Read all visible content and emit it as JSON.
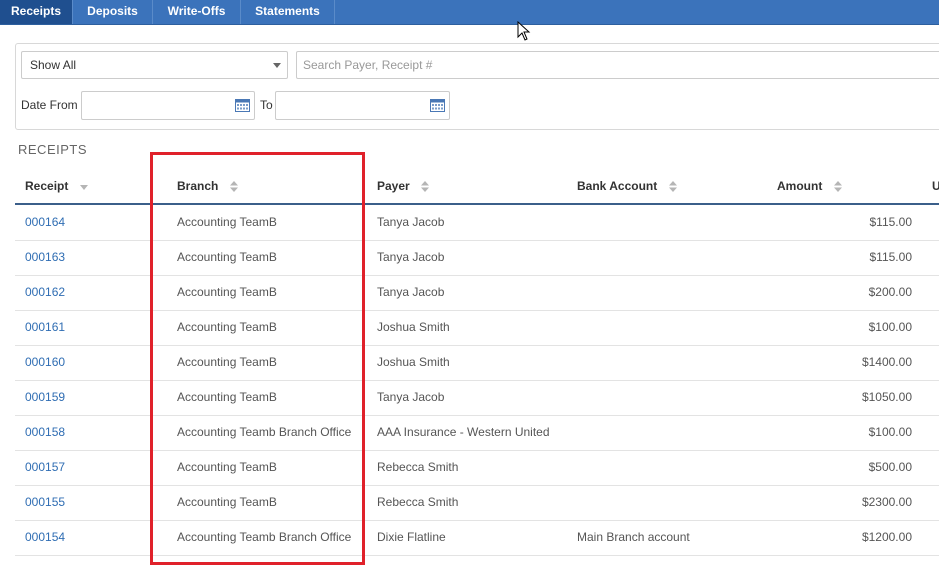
{
  "tabs": [
    "Receipts",
    "Deposits",
    "Write-Offs",
    "Statements"
  ],
  "filters": {
    "show_select_value": "Show All",
    "search_placeholder": "Search Payer, Receipt #",
    "date_from_label": "Date From",
    "to_label": "To"
  },
  "section_title": "RECEIPTS",
  "columns": [
    "Receipt",
    "Branch",
    "Payer",
    "Bank Account",
    "Amount",
    "U"
  ],
  "rows": [
    {
      "receipt": "000164",
      "branch": "Accounting TeamB",
      "payer": "Tanya Jacob",
      "bank": "",
      "amount": "$115.00"
    },
    {
      "receipt": "000163",
      "branch": "Accounting TeamB",
      "payer": "Tanya Jacob",
      "bank": "",
      "amount": "$115.00"
    },
    {
      "receipt": "000162",
      "branch": "Accounting TeamB",
      "payer": "Tanya Jacob",
      "bank": "",
      "amount": "$200.00"
    },
    {
      "receipt": "000161",
      "branch": "Accounting TeamB",
      "payer": "Joshua Smith",
      "bank": "",
      "amount": "$100.00"
    },
    {
      "receipt": "000160",
      "branch": "Accounting TeamB",
      "payer": "Joshua Smith",
      "bank": "",
      "amount": "$1400.00"
    },
    {
      "receipt": "000159",
      "branch": "Accounting TeamB",
      "payer": "Tanya Jacob",
      "bank": "",
      "amount": "$1050.00"
    },
    {
      "receipt": "000158",
      "branch": "Accounting Teamb Branch Office",
      "payer": "AAA Insurance - Western United",
      "bank": "",
      "amount": "$100.00"
    },
    {
      "receipt": "000157",
      "branch": "Accounting TeamB",
      "payer": "Rebecca Smith",
      "bank": "",
      "amount": "$500.00"
    },
    {
      "receipt": "000155",
      "branch": "Accounting TeamB",
      "payer": "Rebecca Smith",
      "bank": "",
      "amount": "$2300.00"
    },
    {
      "receipt": "000154",
      "branch": "Accounting Teamb Branch Office",
      "payer": "Dixie Flatline",
      "bank": "Main Branch account",
      "amount": "$1200.00"
    }
  ],
  "colors": {
    "tabbar": "#3b73bb",
    "link": "#2f6db3",
    "highlight": "#e0212a"
  }
}
